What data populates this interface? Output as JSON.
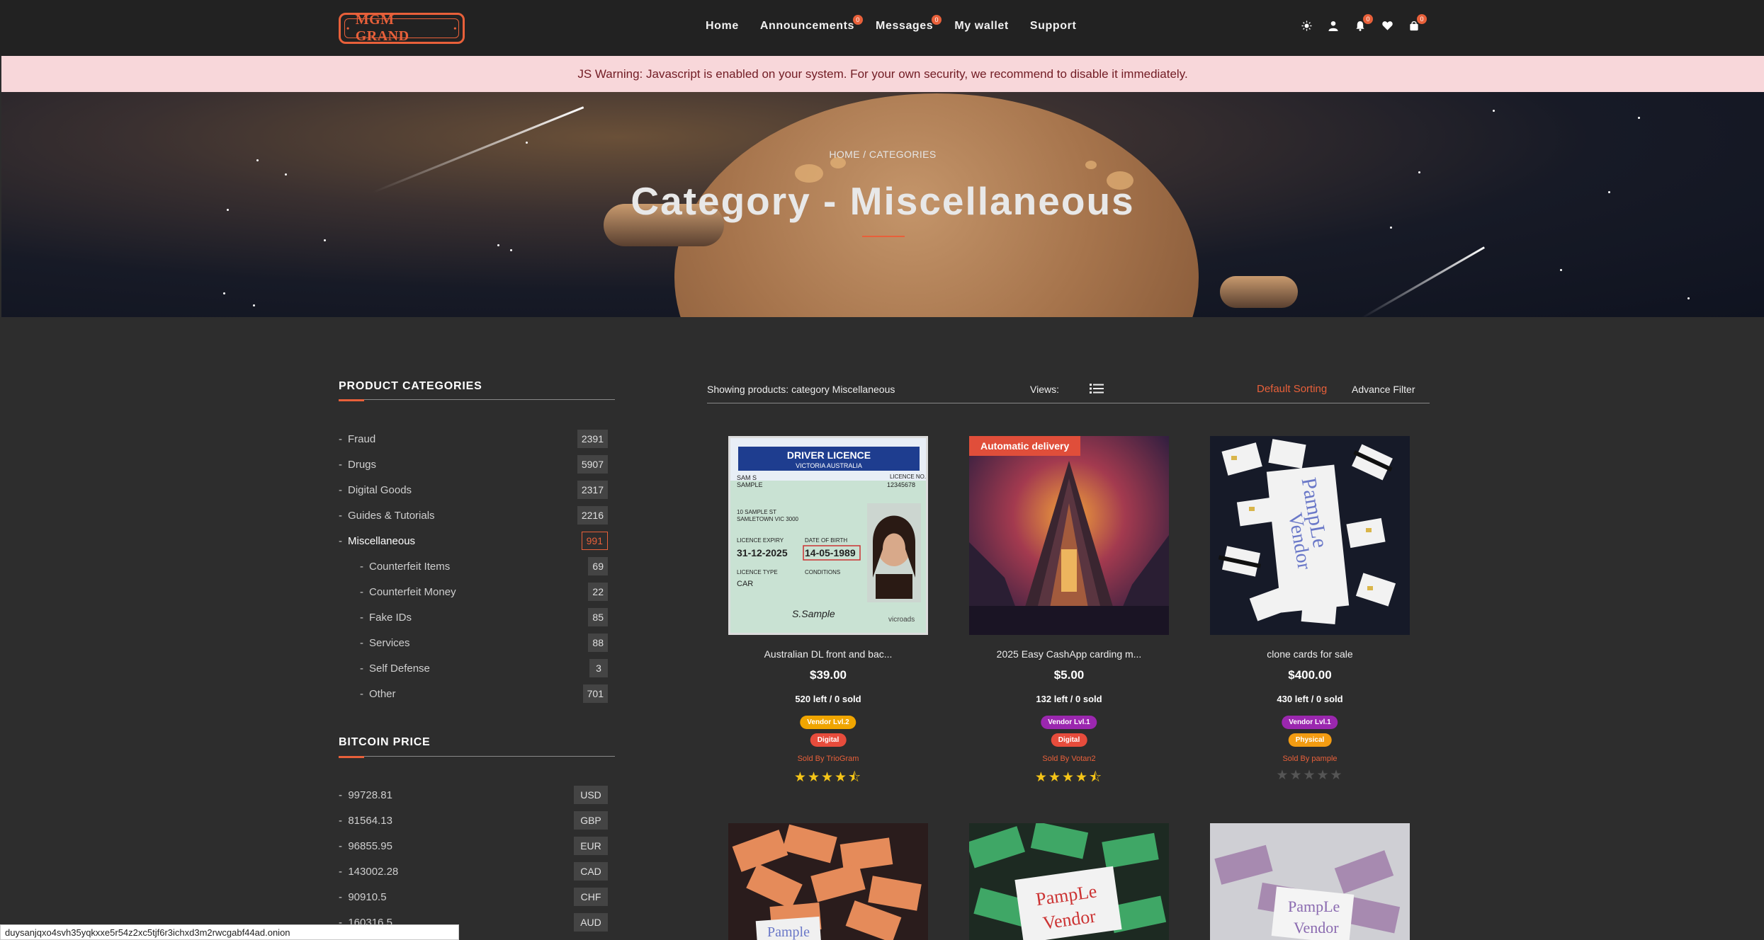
{
  "brand": {
    "logo_text": "MGM GRAND"
  },
  "nav": {
    "items": [
      {
        "label": "Home",
        "badge": ""
      },
      {
        "label": "Announcements",
        "badge": "0"
      },
      {
        "label": "Messages",
        "badge": "0"
      },
      {
        "label": "My wallet",
        "badge": ""
      },
      {
        "label": "Support",
        "badge": ""
      }
    ],
    "icons": [
      {
        "name": "theme-toggle-icon",
        "badge": ""
      },
      {
        "name": "user-icon",
        "badge": ""
      },
      {
        "name": "bell-icon",
        "badge": "0"
      },
      {
        "name": "heart-icon",
        "badge": ""
      },
      {
        "name": "cart-icon",
        "badge": "0"
      }
    ]
  },
  "warning": {
    "text": "JS Warning: Javascript is enabled on your system. For your own security, we recommend to disable it immediately."
  },
  "hero": {
    "breadcrumb": "HOME / CATEGORIES",
    "title": "Category - Miscellaneous"
  },
  "sidebar": {
    "categories_title": "PRODUCT CATEGORIES",
    "categories": [
      {
        "label": "Fraud",
        "count": "2391",
        "active": false,
        "sub": false
      },
      {
        "label": "Drugs",
        "count": "5907",
        "active": false,
        "sub": false
      },
      {
        "label": "Digital Goods",
        "count": "2317",
        "active": false,
        "sub": false
      },
      {
        "label": "Guides & Tutorials",
        "count": "2216",
        "active": false,
        "sub": false
      },
      {
        "label": "Miscellaneous",
        "count": "991",
        "active": true,
        "sub": false
      },
      {
        "label": "Counterfeit Items",
        "count": "69",
        "active": false,
        "sub": true
      },
      {
        "label": "Counterfeit Money",
        "count": "22",
        "active": false,
        "sub": true
      },
      {
        "label": "Fake IDs",
        "count": "85",
        "active": false,
        "sub": true
      },
      {
        "label": "Services",
        "count": "88",
        "active": false,
        "sub": true
      },
      {
        "label": "Self Defense",
        "count": "3",
        "active": false,
        "sub": true
      },
      {
        "label": "Other",
        "count": "701",
        "active": false,
        "sub": true
      }
    ],
    "bitcoin_title": "BITCOIN PRICE",
    "bitcoin": [
      {
        "value": "99728.81",
        "currency": "USD"
      },
      {
        "value": "81564.13",
        "currency": "GBP"
      },
      {
        "value": "96855.95",
        "currency": "EUR"
      },
      {
        "value": "143002.28",
        "currency": "CAD"
      },
      {
        "value": "90910.5",
        "currency": "CHF"
      },
      {
        "value": "160316.5",
        "currency": "AUD"
      }
    ]
  },
  "toolbar": {
    "showing": "Showing products: category Miscellaneous",
    "views_label": "Views:",
    "sort_label": "Default Sorting",
    "filter_label": "Advance Filter"
  },
  "products": [
    {
      "title": "Australian DL front and bac...",
      "price": "$39.00",
      "stock": "520 left / 0 sold",
      "vendor_level": "Vendor Lvl.2",
      "vendor_color": "#f0a500",
      "type": "Digital",
      "type_color": "#e74c3c",
      "seller": "Sold By TrioGram",
      "rating": 4.5,
      "auto_delivery": ""
    },
    {
      "title": "2025 Easy CashApp carding m...",
      "price": "$5.00",
      "stock": "132 left / 0 sold",
      "vendor_level": "Vendor Lvl.1",
      "vendor_color": "#9b27af",
      "type": "Digital",
      "type_color": "#e74c3c",
      "seller": "Sold By Votan2",
      "rating": 4.5,
      "auto_delivery": "Automatic delivery"
    },
    {
      "title": "clone cards for sale",
      "price": "$400.00",
      "stock": "430 left / 0 sold",
      "vendor_level": "Vendor Lvl.1",
      "vendor_color": "#9b27af",
      "type": "Physical",
      "type_color": "#f39c12",
      "seller": "Sold By pample",
      "rating": 0,
      "auto_delivery": ""
    }
  ],
  "status_bar": {
    "url": "duysanjqxo4svh35yqkxxe5r54z2xc5tjf6r3ichxd3m2rwcgabf44ad.onion"
  }
}
